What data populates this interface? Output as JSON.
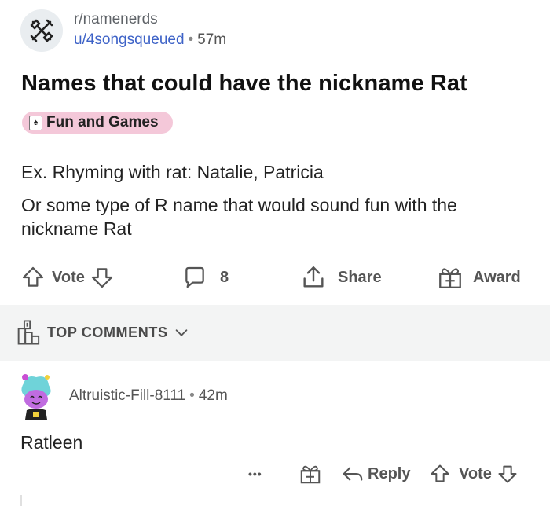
{
  "post": {
    "subreddit": "r/namenerds",
    "author": "u/4songsqueued",
    "separator": "•",
    "age": "57m",
    "title": "Names that could have the nickname Rat",
    "flair": "Fun and Games",
    "body": [
      "Ex. Rhyming with rat: Natalie, Patricia",
      "Or some type of R name that would sound fun with the nickname Rat"
    ],
    "actions": {
      "vote_label": "Vote",
      "comments_count": "8",
      "share_label": "Share",
      "award_label": "Award"
    }
  },
  "section": {
    "top_comments_label": "TOP COMMENTS"
  },
  "comment": {
    "author": "Altruistic-Fill-8111",
    "separator": "•",
    "age": "42m",
    "body": "Ratleen",
    "actions": {
      "more_label": "•••",
      "reply_label": "Reply",
      "vote_label": "Vote"
    }
  },
  "colors": {
    "username": "#3d62c7",
    "flair_bg": "#f4c8d9",
    "band_bg": "#f3f4f4"
  },
  "icons": [
    "subreddit-icon",
    "card-icon",
    "upvote-icon",
    "downvote-icon",
    "comment-icon",
    "share-icon",
    "award-icon",
    "trophy-icon",
    "chevron-down-icon",
    "avatar",
    "reply-icon"
  ]
}
